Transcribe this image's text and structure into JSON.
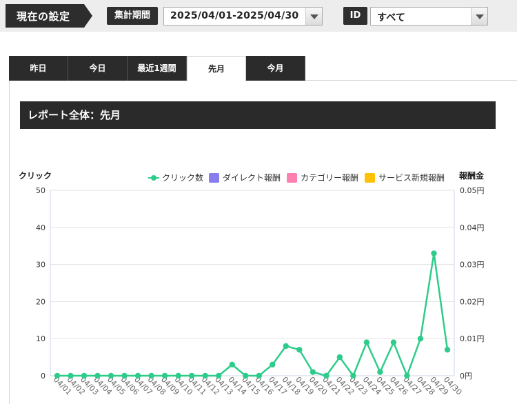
{
  "settings": {
    "current_label": "現在の設定",
    "period_tag": "集計期間",
    "period_value": "2025/04/01-2025/04/30",
    "id_tag": "ID",
    "id_value": "すべて"
  },
  "tabs": [
    {
      "label": "昨日",
      "active": false
    },
    {
      "label": "今日",
      "active": false
    },
    {
      "label": "最近1週間",
      "active": false
    },
    {
      "label": "先月",
      "active": true
    },
    {
      "label": "今月",
      "active": false
    }
  ],
  "report": {
    "title": "レポート全体：先月"
  },
  "chart_data": {
    "type": "line",
    "ylabel": "クリック",
    "y2label": "報酬金",
    "ylim": [
      0,
      50
    ],
    "yticks": [
      "0",
      "10",
      "20",
      "30",
      "40",
      "50"
    ],
    "y2lim": [
      0,
      0.05
    ],
    "y2ticks": [
      "0円",
      "0.01円",
      "0.02円",
      "0.03円",
      "0.04円",
      "0.05円"
    ],
    "legend_position": "top-right",
    "grid": true,
    "categories": [
      "04/01",
      "04/02",
      "04/03",
      "04/04",
      "04/05",
      "04/06",
      "04/07",
      "04/08",
      "04/09",
      "04/10",
      "04/11",
      "04/12",
      "04/13",
      "04/14",
      "04/15",
      "04/16",
      "04/17",
      "04/18",
      "04/19",
      "04/20",
      "04/21",
      "04/22",
      "04/23",
      "04/24",
      "04/25",
      "04/26",
      "04/27",
      "04/28",
      "04/29",
      "04/30"
    ],
    "series": [
      {
        "name": "クリック数",
        "color": "#2ecc8a",
        "kind": "line",
        "axis": "left",
        "values": [
          0,
          0,
          0,
          0,
          0,
          0,
          0,
          0,
          0,
          0,
          0,
          0,
          0,
          3,
          0,
          0,
          3,
          8,
          7,
          1,
          0,
          5,
          0,
          9,
          1,
          9,
          0,
          10,
          33,
          7
        ]
      },
      {
        "name": "ダイレクト報酬",
        "color": "#8a7df0",
        "kind": "bar",
        "axis": "right",
        "values": [
          0,
          0,
          0,
          0,
          0,
          0,
          0,
          0,
          0,
          0,
          0,
          0,
          0,
          0,
          0,
          0,
          0,
          0,
          0,
          0,
          0,
          0,
          0,
          0,
          0,
          0,
          0,
          0,
          0,
          0
        ]
      },
      {
        "name": "カテゴリー報酬",
        "color": "#ff7fb0",
        "kind": "bar",
        "axis": "right",
        "values": [
          0,
          0,
          0,
          0,
          0,
          0,
          0,
          0,
          0,
          0,
          0,
          0,
          0,
          0,
          0,
          0,
          0,
          0,
          0,
          0,
          0,
          0,
          0,
          0,
          0,
          0,
          0,
          0,
          0,
          0
        ]
      },
      {
        "name": "サービス新規報酬",
        "color": "#ffc107",
        "kind": "bar",
        "axis": "right",
        "values": [
          0,
          0,
          0,
          0,
          0,
          0,
          0,
          0,
          0,
          0,
          0,
          0,
          0,
          0,
          0,
          0,
          0,
          0,
          0,
          0,
          0,
          0,
          0,
          0,
          0,
          0,
          0,
          0,
          0,
          0
        ]
      }
    ]
  }
}
